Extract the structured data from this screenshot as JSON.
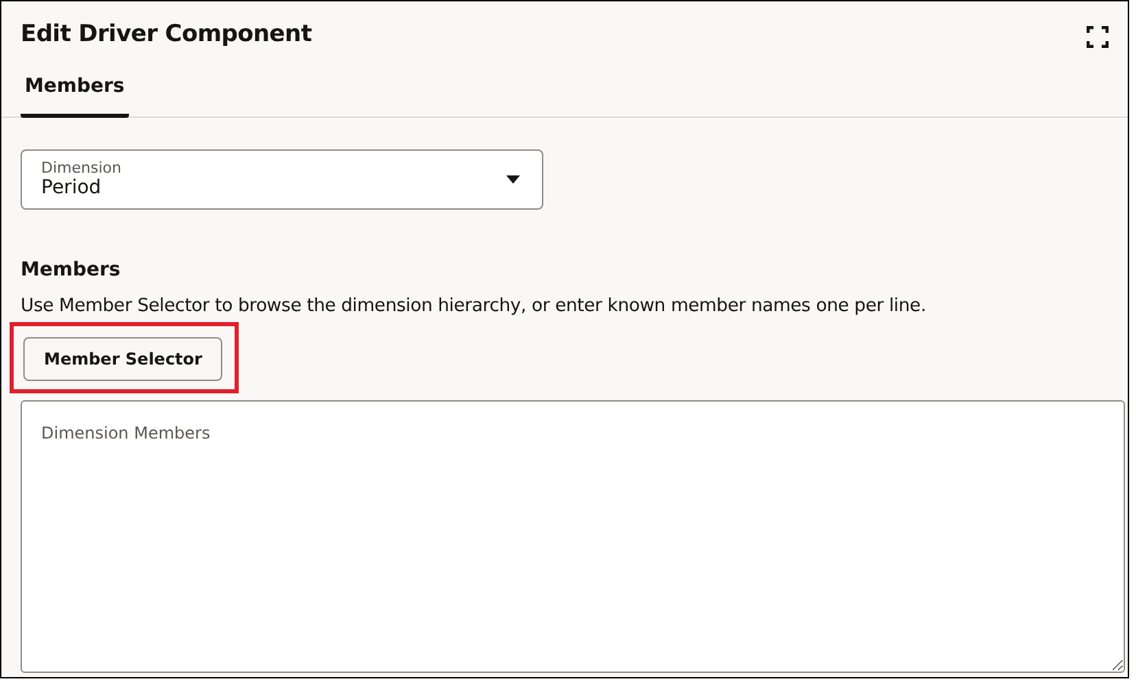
{
  "dialog": {
    "title": "Edit Driver Component"
  },
  "tabs": [
    {
      "label": "Members",
      "selected": true
    }
  ],
  "dimension_select": {
    "label": "Dimension",
    "value": "Period"
  },
  "members_section": {
    "heading": "Members",
    "description": "Use Member Selector to browse the dimension hierarchy, or enter known member names one per line.",
    "button": {
      "label": "Member Selector",
      "highlighted": true
    },
    "members_field": {
      "placeholder": "Dimension Members"
    }
  }
}
